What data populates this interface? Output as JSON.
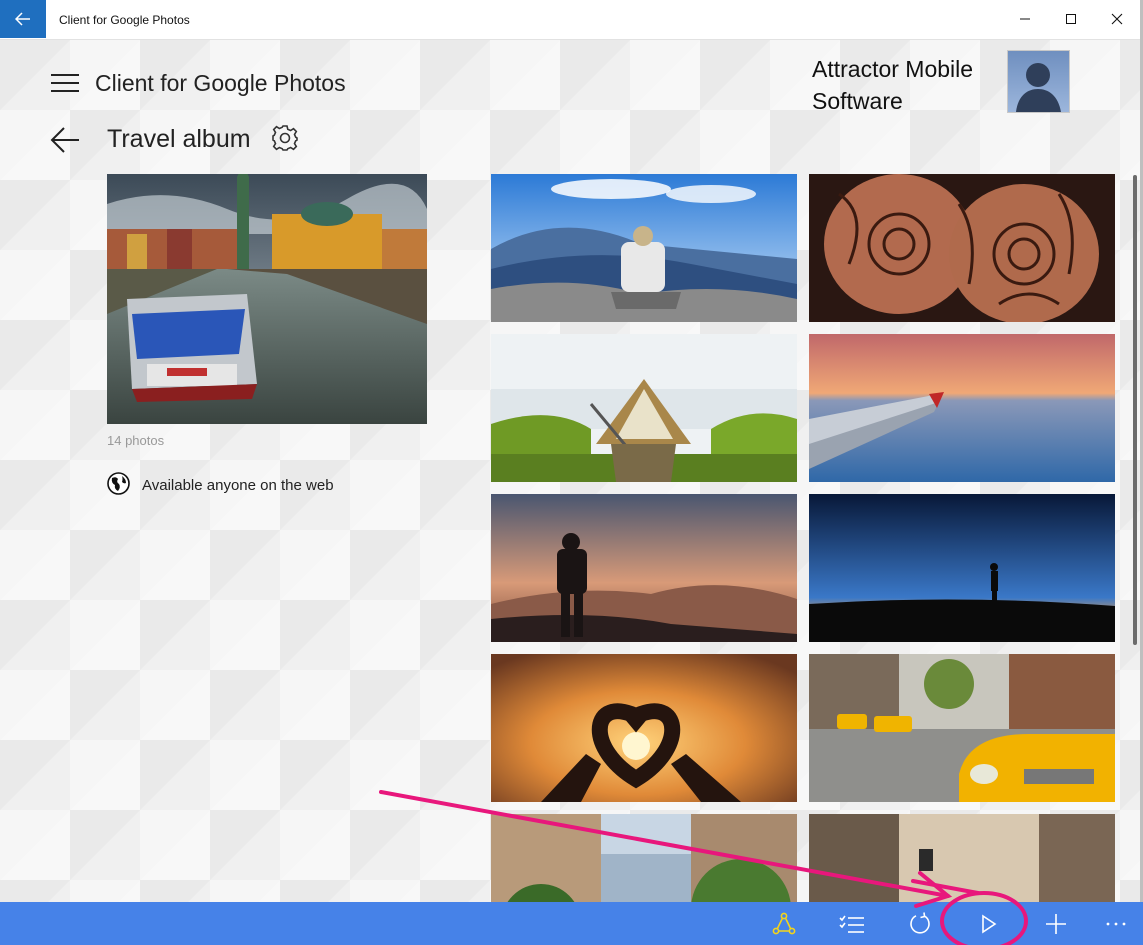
{
  "window": {
    "title": "Client for Google Photos",
    "back_icon": "arrow-left-icon",
    "accent": "#1f6fbf"
  },
  "header": {
    "app_title": "Client for Google Photos",
    "user_name": "Attractor Mobile Software"
  },
  "album": {
    "title": "Travel album",
    "photo_count": "14 photos",
    "sharing": "Available anyone on the web"
  },
  "photos": [
    "mountain-hiker",
    "henna-hands",
    "canoe-lake",
    "airplane-wing-sunset",
    "backpacker-silhouette",
    "person-silhouette-dusk",
    "heart-hands-sun",
    "yellow-taxi-street",
    "city-street-trees",
    "street-bicycles"
  ],
  "commandbar": {
    "color": "#4682e8",
    "buttons": [
      "share-icon",
      "select-icon",
      "refresh-icon",
      "play-icon",
      "add-icon",
      "more-icon"
    ],
    "highlight": "#e8177c"
  }
}
